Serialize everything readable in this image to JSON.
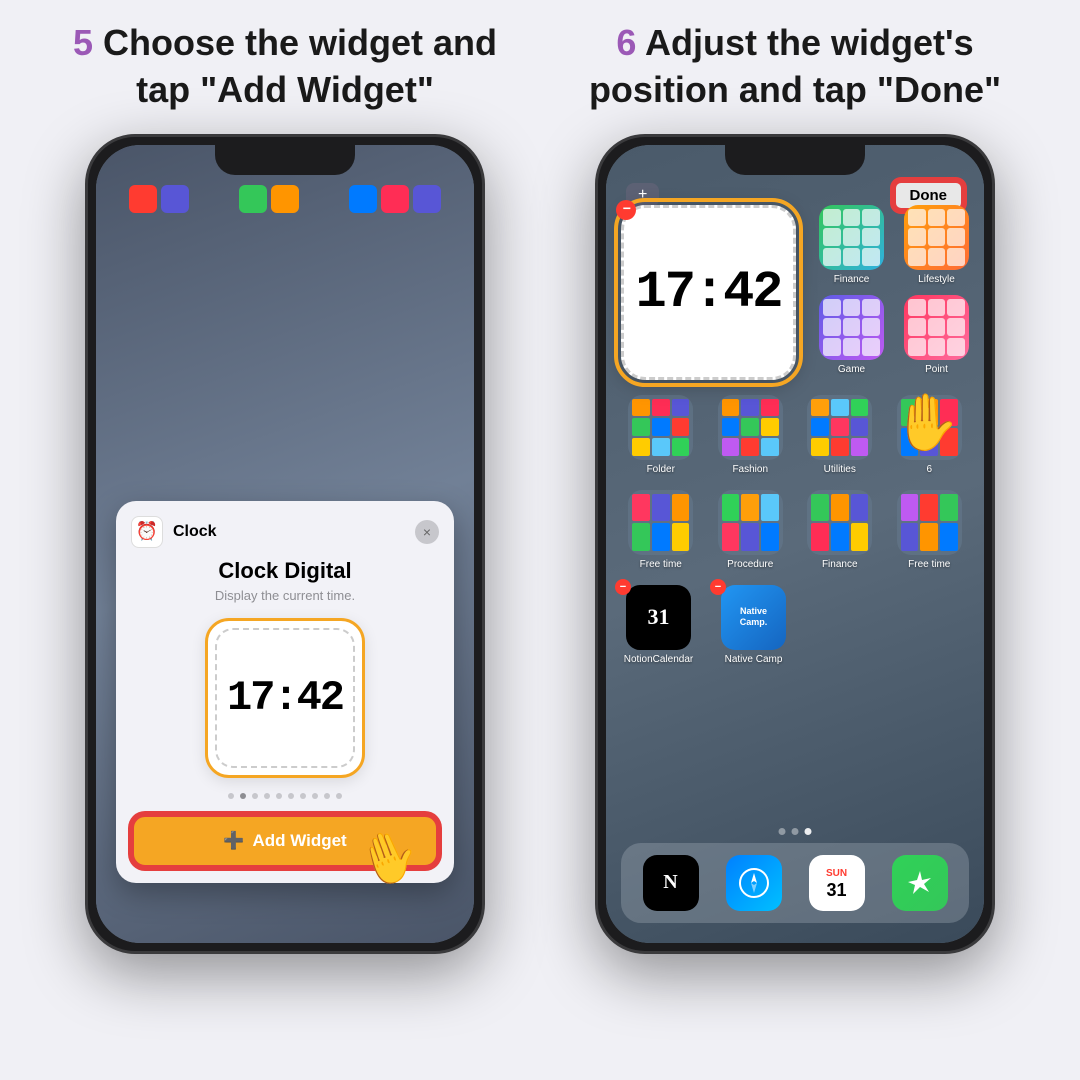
{
  "page": {
    "background": "#f0f0f5"
  },
  "step5": {
    "number": "5",
    "text_plain": " Choose the widget and tap ",
    "text_bold": "\"Add Widget\"",
    "full_text": "5 Choose the widget and tap \"Add Widget\""
  },
  "step6": {
    "number": "6",
    "text_plain": " Adjust the widget's position and tap ",
    "text_bold": "\"Done\"",
    "full_text": "6 Adjust the widget's position and tap \"Done\""
  },
  "phone1": {
    "modal": {
      "app_name": "Clock",
      "widget_name": "Clock Digital",
      "widget_desc": "Display the current time.",
      "time_display": "17:42",
      "add_button": "Add Widget",
      "close_x": "×"
    },
    "dots": [
      false,
      true,
      false,
      false,
      false,
      false,
      false,
      false,
      false,
      false
    ]
  },
  "phone2": {
    "plus_label": "+",
    "done_label": "Done",
    "time_display": "17:42",
    "app_groups": [
      {
        "label": "Finance",
        "color": "finance"
      },
      {
        "label": "Lifestyle",
        "color": "lifestyle"
      },
      {
        "label": "Game",
        "color": "game"
      },
      {
        "label": "Point",
        "color": "point"
      }
    ],
    "app_rows": [
      [
        {
          "label": "Folder",
          "type": "folder"
        },
        {
          "label": "Fashion",
          "type": "folder"
        },
        {
          "label": "Utilities",
          "type": "folder"
        },
        {
          "label": "6",
          "type": "folder"
        }
      ],
      [
        {
          "label": "Free time",
          "type": "folder"
        },
        {
          "label": "Procedure",
          "type": "folder"
        },
        {
          "label": "Finance",
          "type": "folder"
        },
        {
          "label": "Free time",
          "type": "folder"
        }
      ]
    ],
    "bottom_apps": [
      {
        "label": "NotionCalendar",
        "type": "notion"
      },
      {
        "label": "Native Camp",
        "type": "native"
      }
    ],
    "dock_apps": [
      "N",
      "🧭",
      "31",
      "✦"
    ],
    "page_dots": [
      false,
      false,
      true
    ]
  }
}
